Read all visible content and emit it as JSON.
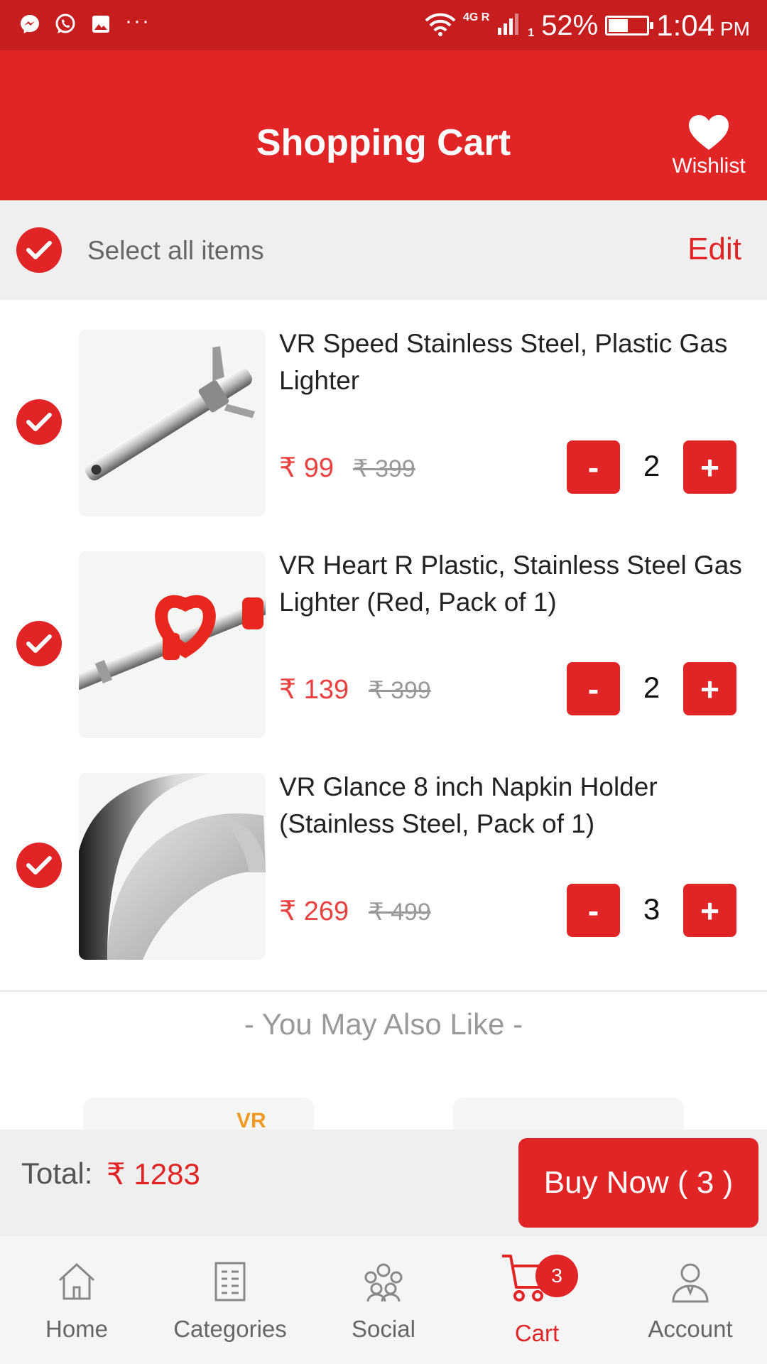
{
  "status_bar": {
    "left_icons": [
      "messenger-icon",
      "whatsapp-icon",
      "gallery-icon"
    ],
    "more": "···",
    "network": "4G R",
    "sim": "1",
    "battery_percent": "52%",
    "battery_level": 0.52,
    "time": "1:04",
    "ampm": "PM"
  },
  "header": {
    "title": "Shopping Cart",
    "wishlist_label": "Wishlist"
  },
  "select_all": {
    "label": "Select all items",
    "checked": true,
    "edit_label": "Edit"
  },
  "cart_items": [
    {
      "name": "VR Speed Stainless Steel, Plastic Gas Lighter",
      "price": "₹ 99",
      "mrp": "₹ 399",
      "quantity": "2",
      "checked": true,
      "image": "steel-gas-lighter"
    },
    {
      "name": "VR Heart R Plastic, Stainless Steel Gas Lighter  (Red, Pack of 1)",
      "price": "₹ 139",
      "mrp": "₹ 399",
      "quantity": "2",
      "checked": true,
      "image": "red-heart-gas-lighter"
    },
    {
      "name": "VR Glance 8 inch Napkin Holder (Stainless Steel, Pack of 1)",
      "price": "₹ 269",
      "mrp": "₹ 499",
      "quantity": "3",
      "checked": true,
      "image": "steel-napkin-holder"
    }
  ],
  "qty_controls": {
    "minus": "-",
    "plus": "+"
  },
  "recommendations": {
    "heading": "- You May Also Like -",
    "card1_logo": "VR"
  },
  "footer": {
    "total_label": "Total:",
    "total_value": "₹ 1283",
    "buy_button": "Buy Now ( 3 )"
  },
  "bottom_nav": {
    "items": [
      {
        "label": "Home",
        "icon": "home-icon"
      },
      {
        "label": "Categories",
        "icon": "categories-icon"
      },
      {
        "label": "Social",
        "icon": "social-icon"
      },
      {
        "label": "Cart",
        "icon": "cart-icon",
        "active": true,
        "badge": "3"
      },
      {
        "label": "Account",
        "icon": "account-icon"
      }
    ]
  },
  "colors": {
    "status_bar": "#c61d1f",
    "brand_red": "#e12425",
    "price_red": "#e8413f",
    "background_gray": "#efefef"
  }
}
